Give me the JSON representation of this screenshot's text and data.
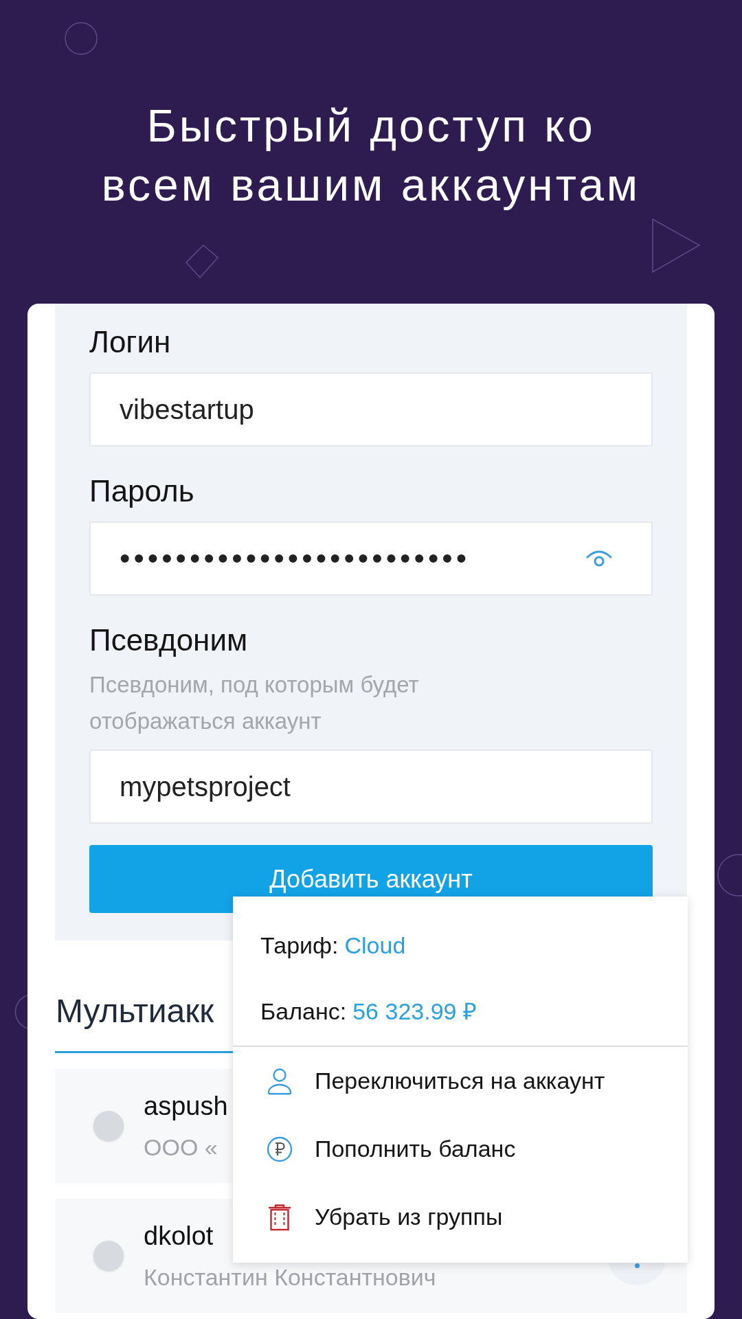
{
  "header": {
    "title": "Быстрый доступ ко всем вашим аккаунтам"
  },
  "form": {
    "fields": [
      {
        "kind": "text",
        "label": "Логин",
        "value": "vibestartup"
      },
      {
        "kind": "password",
        "label": "Пароль",
        "value": "•••••••••••••••••••••••••"
      },
      {
        "kind": "text",
        "label": "Псевдоним",
        "hint": "Псевдоним, под которым будет отображаться аккаунт",
        "value": "mypetsproject"
      }
    ],
    "submit_button": "Добавить аккаунт"
  },
  "accounts_section": {
    "title": "Мультиакк",
    "accounts": [
      {
        "login": "aspush",
        "subtitle": "ООО «",
        "selected": false
      },
      {
        "login": "dkolot",
        "subtitle": "Константин Константнович",
        "selected": false,
        "menu_button": true
      }
    ]
  },
  "account_menu": {
    "details": [
      {
        "label": "Тариф:",
        "value": "Cloud"
      },
      {
        "label": "Баланс:",
        "value": "56 323.99 ₽"
      }
    ],
    "items": [
      {
        "kind": "switch",
        "label": "Переключиться на аккаунт"
      },
      {
        "kind": "topup",
        "label": "Пополнить баланс"
      },
      {
        "kind": "remove",
        "label": "Убрать из группы"
      }
    ]
  }
}
